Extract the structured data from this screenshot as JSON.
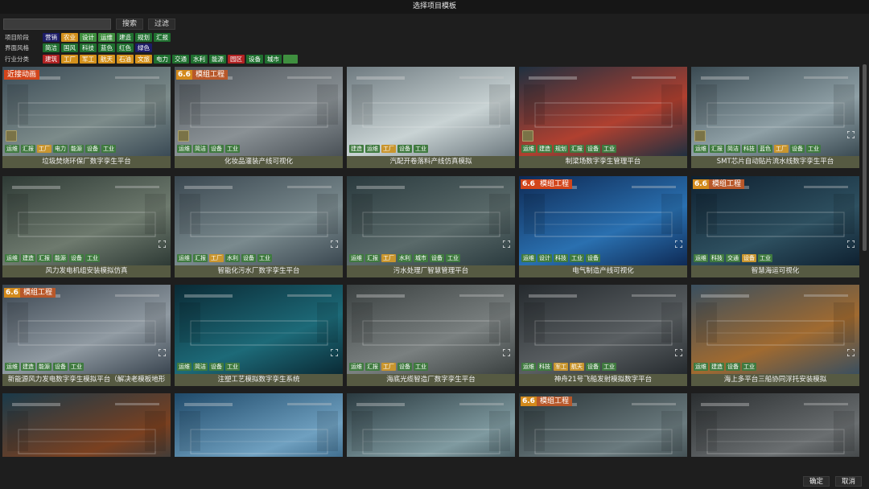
{
  "window": {
    "title": "选择项目模板"
  },
  "search": {
    "placeholder": "",
    "search_label": "搜索",
    "filter_label": "过滤"
  },
  "filters": [
    {
      "label": "项目阶段",
      "chips": [
        {
          "text": "营销",
          "color": "#1c1c66"
        },
        {
          "text": "农业",
          "color": "#d4911c"
        },
        {
          "text": "设计",
          "color": "#3f8f3f"
        },
        {
          "text": "运维",
          "color": "#3f8f3f"
        },
        {
          "text": "建造",
          "color": "#1f6f2f"
        },
        {
          "text": "规划",
          "color": "#1f6f2f"
        },
        {
          "text": "汇报",
          "color": "#1f6f2f"
        }
      ]
    },
    {
      "label": "界面风格",
      "chips": [
        {
          "text": "简洁",
          "color": "#1f6f2f"
        },
        {
          "text": "国风",
          "color": "#1f6f2f"
        },
        {
          "text": "科技",
          "color": "#1f6f2f"
        },
        {
          "text": "蓝色",
          "color": "#1f6f2f"
        },
        {
          "text": "红色",
          "color": "#1f6f2f"
        },
        {
          "text": "绿色",
          "color": "#1c1c66"
        }
      ]
    },
    {
      "label": "行业分类",
      "chips": [
        {
          "text": "建筑",
          "color": "#b22222"
        },
        {
          "text": "工厂",
          "color": "#d4911c"
        },
        {
          "text": "军工",
          "color": "#d4911c"
        },
        {
          "text": "航天",
          "color": "#d4911c"
        },
        {
          "text": "石油",
          "color": "#d4911c"
        },
        {
          "text": "文旅",
          "color": "#d4911c"
        },
        {
          "text": "电力",
          "color": "#1f6f2f"
        },
        {
          "text": "交通",
          "color": "#1f6f2f"
        },
        {
          "text": "水利",
          "color": "#1f6f2f"
        },
        {
          "text": "能源",
          "color": "#1f6f2f"
        },
        {
          "text": "园区",
          "color": "#b22222"
        },
        {
          "text": "设备",
          "color": "#1f6f2f"
        },
        {
          "text": "城市",
          "color": "#1f6f2f"
        },
        {
          "text": "",
          "color": "#3f8f3f"
        }
      ]
    }
  ],
  "templates": [
    {
      "title": "垃圾焚烧环保厂数字孪生平台",
      "tags": [
        "运维",
        "汇报",
        "工厂",
        "电力",
        "能源",
        "设备",
        "工业"
      ],
      "yellow": [
        "工厂"
      ],
      "badge_text": "近接动画",
      "badge_version": "",
      "badge_style": "red",
      "theme": [
        "#3a4a55",
        "#7c8b8a"
      ],
      "spark": true,
      "expand": false
    },
    {
      "title": "化妆品灌装产线可视化",
      "tags": [
        "运维",
        "简洁",
        "设备",
        "工业"
      ],
      "yellow": [],
      "badge_version": "6.6",
      "badge_text": "模组工程",
      "badge_style": "",
      "theme": [
        "#4a5157",
        "#8a9195"
      ],
      "spark": true,
      "expand": false
    },
    {
      "title": "汽配开卷落料产线仿真模拟",
      "tags": [
        "建造",
        "运维",
        "工厂",
        "设备",
        "工业"
      ],
      "yellow": [
        "工厂"
      ],
      "badge_version": "",
      "badge_text": "",
      "badge_style": "",
      "theme": [
        "#6e7a80",
        "#c9d3d4"
      ],
      "spark": false,
      "expand": false
    },
    {
      "title": "制梁场数字孪生管理平台",
      "tags": [
        "运维",
        "建造",
        "规划",
        "汇报",
        "设备",
        "工业"
      ],
      "yellow": [],
      "badge_version": "",
      "badge_text": "",
      "badge_style": "",
      "theme": [
        "#203040",
        "#b04030"
      ],
      "spark": true,
      "expand": false
    },
    {
      "title": "SMT芯片自动贴片流水线数字孪生平台",
      "tags": [
        "运维",
        "汇报",
        "简洁",
        "科技",
        "蓝色",
        "工厂",
        "设备",
        "工业"
      ],
      "yellow": [
        "工厂"
      ],
      "badge_version": "",
      "badge_text": "",
      "badge_style": "",
      "theme": [
        "#3a4a52",
        "#8fa0a6"
      ],
      "spark": true,
      "expand": true
    },
    {
      "title": "风力发电机组安装模拟仿真",
      "tags": [
        "运维",
        "建造",
        "汇报",
        "能源",
        "设备",
        "工业"
      ],
      "yellow": [],
      "badge_version": "",
      "badge_text": "",
      "badge_style": "",
      "theme": [
        "#2e3a35",
        "#6e7a6e"
      ],
      "spark": false,
      "expand": true
    },
    {
      "title": "智能化污水厂数字孪生平台",
      "tags": [
        "运维",
        "汇报",
        "工厂",
        "水利",
        "设备",
        "工业"
      ],
      "yellow": [
        "工厂"
      ],
      "badge_version": "",
      "badge_text": "",
      "badge_style": "",
      "theme": [
        "#3a4750",
        "#7a8a8e"
      ],
      "spark": false,
      "expand": true
    },
    {
      "title": "污水处理厂智慧管理平台",
      "tags": [
        "运维",
        "汇报",
        "工厂",
        "水利",
        "城市",
        "设备",
        "工业"
      ],
      "yellow": [
        "工厂"
      ],
      "badge_version": "",
      "badge_text": "",
      "badge_style": "",
      "theme": [
        "#2a3a3e",
        "#5a6a6a"
      ],
      "spark": false,
      "expand": true
    },
    {
      "title": "电气制造产线可视化",
      "tags": [
        "运维",
        "设计",
        "科技",
        "工业",
        "设备"
      ],
      "yellow": [],
      "badge_version": "6.6",
      "badge_text": "模组工程",
      "badge_style": "red",
      "theme": [
        "#0e2a55",
        "#2a70b0"
      ],
      "spark": false,
      "expand": true
    },
    {
      "title": "智慧海运可视化",
      "tags": [
        "运维",
        "科技",
        "交通",
        "设备",
        "工业"
      ],
      "yellow": [
        "设备"
      ],
      "badge_version": "6.6",
      "badge_text": "模组工程",
      "badge_style": "",
      "theme": [
        "#0e2030",
        "#2e5060"
      ],
      "spark": false,
      "expand": true
    },
    {
      "title": "新能源风力发电数字孪生模拟平台（解决老模板地形",
      "tags": [
        "运维",
        "建造",
        "能源",
        "设备",
        "工业"
      ],
      "yellow": [],
      "badge_version": "6.6",
      "badge_text": "模组工程",
      "badge_style": "",
      "theme": [
        "#3a4550",
        "#909aa2"
      ],
      "spark": false,
      "expand": true
    },
    {
      "title": "注塑工艺模拟数字孪生系统",
      "tags": [
        "运维",
        "简洁",
        "设备",
        "工业"
      ],
      "yellow": [],
      "badge_version": "",
      "badge_text": "",
      "badge_style": "",
      "theme": [
        "#0a2a35",
        "#1d6a78"
      ],
      "spark": false,
      "expand": true
    },
    {
      "title": "海底光缆智造厂数字孪生平台",
      "tags": [
        "运维",
        "汇报",
        "工厂",
        "设备",
        "工业"
      ],
      "yellow": [
        "工厂"
      ],
      "badge_version": "",
      "badge_text": "",
      "badge_style": "",
      "theme": [
        "#3a4040",
        "#7a8080"
      ],
      "spark": false,
      "expand": true
    },
    {
      "title": "神舟21号飞船发射模拟数字平台",
      "tags": [
        "运维",
        "科技",
        "军工",
        "航天",
        "设备",
        "工业"
      ],
      "yellow": [
        "军工",
        "航天"
      ],
      "badge_version": "",
      "badge_text": "",
      "badge_style": "",
      "theme": [
        "#252a2e",
        "#5a5f62"
      ],
      "spark": false,
      "expand": true
    },
    {
      "title": "海上多平台三船协同浮托安装模拟",
      "tags": [
        "运维",
        "建造",
        "设备",
        "工业"
      ],
      "yellow": [],
      "badge_version": "",
      "badge_text": "",
      "badge_style": "",
      "theme": [
        "#3a4f5f",
        "#a06a30"
      ],
      "spark": false,
      "expand": true
    },
    {
      "title": "",
      "tags": [],
      "yellow": [],
      "badge_version": "",
      "badge_text": "",
      "badge_style": "",
      "theme": [
        "#1a3a4a",
        "#7a4020"
      ],
      "spark": false,
      "expand": false
    },
    {
      "title": "",
      "tags": [],
      "yellow": [],
      "badge_version": "",
      "badge_text": "",
      "badge_style": "",
      "theme": [
        "#1f4a6a",
        "#6fa0c0"
      ],
      "spark": false,
      "expand": false
    },
    {
      "title": "",
      "tags": [],
      "yellow": [],
      "badge_version": "",
      "badge_text": "",
      "badge_style": "",
      "theme": [
        "#2a3a40",
        "#7f9aa0"
      ],
      "spark": false,
      "expand": false
    },
    {
      "title": "",
      "tags": [],
      "yellow": [],
      "badge_version": "6.6",
      "badge_text": "模组工程",
      "badge_style": "",
      "theme": [
        "#2a3538",
        "#6a7a7e"
      ],
      "spark": false,
      "expand": false
    },
    {
      "title": "",
      "tags": [],
      "yellow": [],
      "badge_version": "",
      "badge_text": "",
      "badge_style": "",
      "theme": [
        "#2a2e30",
        "#6a6e70"
      ],
      "spark": false,
      "expand": false
    }
  ],
  "footer": {
    "ok_label": "确定",
    "cancel_label": "取消"
  }
}
